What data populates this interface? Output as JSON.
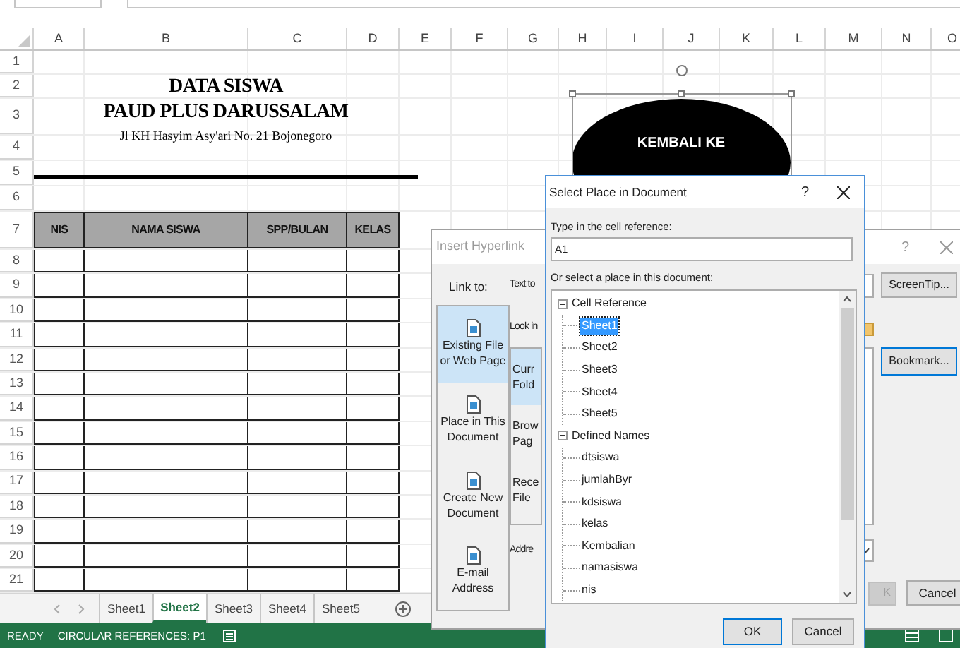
{
  "sheet": {
    "columns": [
      "A",
      "B",
      "C",
      "D",
      "E",
      "F",
      "G",
      "H",
      "I",
      "J",
      "K",
      "L",
      "M",
      "N",
      "O"
    ],
    "rows": [
      "1",
      "2",
      "3",
      "4",
      "5",
      "6",
      "7",
      "8",
      "9",
      "10",
      "11",
      "12",
      "13",
      "14",
      "15",
      "16",
      "17",
      "18",
      "19",
      "20",
      "21"
    ],
    "title_lines": [
      "DATA SISWA",
      "PAUD PLUS DARUSSALAM"
    ],
    "address": "Jl KH Hasyim Asy'ari No. 21 Bojonegoro",
    "table_columns": [
      "NIS",
      "NAMA SISWA",
      "SPP/BULAN",
      "KELAS"
    ]
  },
  "shape": {
    "text": "KEMBALI KE"
  },
  "insert_hyperlink": {
    "title": "Insert Hyperlink",
    "help": "?",
    "link_to_label": "Link to:",
    "link_options": [
      {
        "lines": [
          "Existing File",
          "or Web Page"
        ],
        "selected": true
      },
      {
        "lines": [
          "Place in This",
          "Document"
        ],
        "selected": false
      },
      {
        "lines": [
          "Create New",
          "Document"
        ],
        "selected": false
      },
      {
        "lines": [
          "E-mail",
          "Address"
        ],
        "selected": false
      }
    ],
    "text_to_label": "Text to",
    "look_in_label": "Look in",
    "browse_options": [
      {
        "lines": [
          "Curr",
          "Fold"
        ],
        "selected": true
      },
      {
        "lines": [
          "Brow",
          "Pag"
        ],
        "selected": false
      },
      {
        "lines": [
          "Rece",
          "File"
        ],
        "selected": false
      }
    ],
    "address_label": "Addre",
    "screentip_button": "ScreenTip...",
    "bookmark_button": "Bookmark...",
    "ok": {
      "label": "K",
      "disabled": true
    },
    "cancel": "Cancel"
  },
  "select_place": {
    "title": "Select Place in Document",
    "help": "?",
    "cell_ref_label": "Type in the cell reference:",
    "cell_ref_value": "A1",
    "select_label": "Or select a place in this document:",
    "tree": [
      {
        "label": "Cell Reference",
        "expanded": true,
        "children": [
          {
            "label": "Sheet1",
            "selected": true
          },
          {
            "label": "Sheet2",
            "selected": false
          },
          {
            "label": "Sheet3",
            "selected": false
          },
          {
            "label": "Sheet4",
            "selected": false
          },
          {
            "label": "Sheet5",
            "selected": false
          }
        ]
      },
      {
        "label": "Defined Names",
        "expanded": true,
        "children": [
          {
            "label": "dtsiswa",
            "selected": false
          },
          {
            "label": "jumlahByr",
            "selected": false
          },
          {
            "label": "kdsiswa",
            "selected": false
          },
          {
            "label": "kelas",
            "selected": false
          },
          {
            "label": "Kembalian",
            "selected": false
          },
          {
            "label": "namasiswa",
            "selected": false
          },
          {
            "label": "nis",
            "selected": false
          }
        ]
      }
    ],
    "ok": "OK",
    "cancel": "Cancel"
  },
  "sheet_tabs": [
    {
      "label": "Sheet1",
      "selected": false
    },
    {
      "label": "Sheet2",
      "selected": true
    },
    {
      "label": "Sheet3",
      "selected": false
    },
    {
      "label": "Sheet4",
      "selected": false
    },
    {
      "label": "Sheet5",
      "selected": false
    }
  ],
  "status_bar": {
    "mode": "READY",
    "circular": "CIRCULAR REFERENCES: P1"
  }
}
